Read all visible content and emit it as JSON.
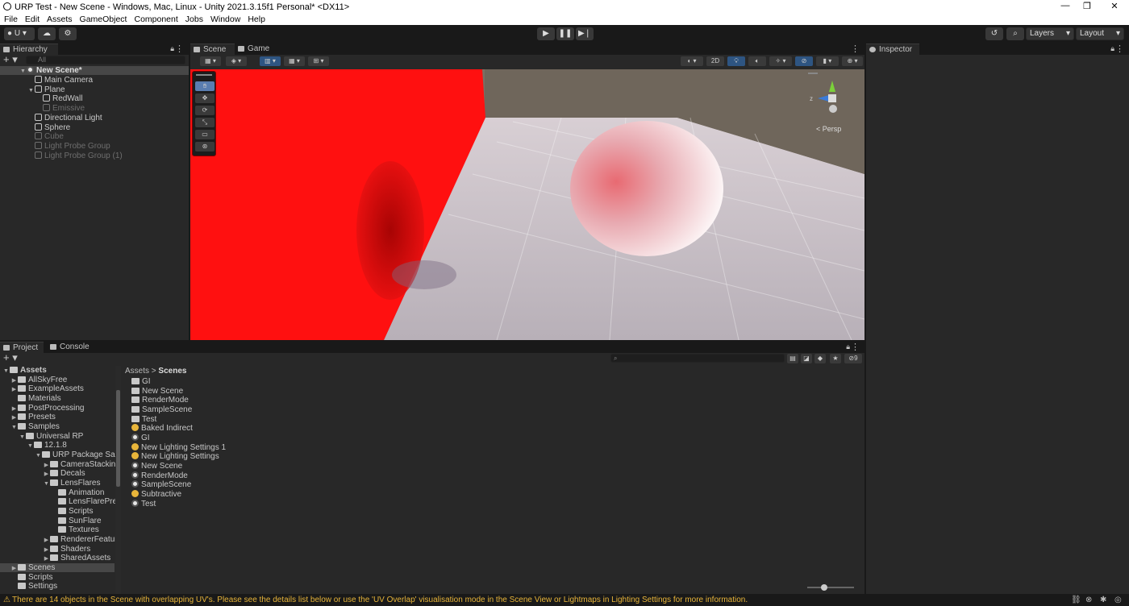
{
  "window": {
    "title": "URP Test - New Scene - Windows, Mac, Linux - Unity 2021.3.15f1 Personal* <DX11>",
    "controls": [
      "—",
      "❐",
      "✕"
    ]
  },
  "menu": [
    "File",
    "Edit",
    "Assets",
    "GameObject",
    "Component",
    "Jobs",
    "Window",
    "Help"
  ],
  "toolbar": {
    "account_label": "U",
    "layers_label": "Layers",
    "layout_label": "Layout"
  },
  "hierarchy": {
    "tab_label": "Hierarchy",
    "add_label": "+",
    "search_placeholder": "All",
    "scene_name": "New Scene*",
    "items": [
      {
        "label": "Main Camera",
        "depth": 1,
        "dim": false,
        "has_arrow": false
      },
      {
        "label": "Plane",
        "depth": 1,
        "dim": false,
        "has_arrow": true
      },
      {
        "label": "RedWall",
        "depth": 2,
        "dim": false,
        "has_arrow": false
      },
      {
        "label": "Emissive",
        "depth": 2,
        "dim": true,
        "has_arrow": false
      },
      {
        "label": "Directional Light",
        "depth": 1,
        "dim": false,
        "has_arrow": false
      },
      {
        "label": "Sphere",
        "depth": 1,
        "dim": false,
        "has_arrow": false
      },
      {
        "label": "Cube",
        "depth": 1,
        "dim": true,
        "has_arrow": false
      },
      {
        "label": "Light Probe Group",
        "depth": 1,
        "dim": true,
        "has_arrow": false
      },
      {
        "label": "Light Probe Group (1)",
        "depth": 1,
        "dim": true,
        "has_arrow": false
      }
    ]
  },
  "scene": {
    "tabs": [
      "Scene",
      "Game"
    ],
    "mode_2d": "2D",
    "persp_label": "Persp",
    "gizmo_axis": "z",
    "colors": {
      "red_wall": "#ff1010",
      "sky": "#7a7064",
      "floor": "#c9c2c8"
    }
  },
  "inspector": {
    "tab_label": "Inspector"
  },
  "project": {
    "tabs": [
      "Project",
      "Console"
    ],
    "add_label": "+",
    "breadcrumb": [
      "Assets",
      "Scenes"
    ],
    "hidden_count": "9",
    "tree": [
      {
        "label": "Assets",
        "depth": 0,
        "arrow": "▼",
        "bold": true
      },
      {
        "label": "AllSkyFree",
        "depth": 1,
        "arrow": "▶"
      },
      {
        "label": "ExampleAssets",
        "depth": 1,
        "arrow": "▶"
      },
      {
        "label": "Materials",
        "depth": 1,
        "arrow": ""
      },
      {
        "label": "PostProcessing",
        "depth": 1,
        "arrow": "▶"
      },
      {
        "label": "Presets",
        "depth": 1,
        "arrow": "▶"
      },
      {
        "label": "Samples",
        "depth": 1,
        "arrow": "▼"
      },
      {
        "label": "Universal RP",
        "depth": 2,
        "arrow": "▼"
      },
      {
        "label": "12.1.8",
        "depth": 3,
        "arrow": "▼"
      },
      {
        "label": "URP Package Sam",
        "depth": 4,
        "arrow": "▼"
      },
      {
        "label": "CameraStackin",
        "depth": 5,
        "arrow": "▶"
      },
      {
        "label": "Decals",
        "depth": 5,
        "arrow": "▶"
      },
      {
        "label": "LensFlares",
        "depth": 5,
        "arrow": "▼"
      },
      {
        "label": "Animation",
        "depth": 6,
        "arrow": ""
      },
      {
        "label": "LensFlarePre",
        "depth": 6,
        "arrow": ""
      },
      {
        "label": "Scripts",
        "depth": 6,
        "arrow": ""
      },
      {
        "label": "SunFlare",
        "depth": 6,
        "arrow": ""
      },
      {
        "label": "Textures",
        "depth": 6,
        "arrow": ""
      },
      {
        "label": "RendererFeatur",
        "depth": 5,
        "arrow": "▶"
      },
      {
        "label": "Shaders",
        "depth": 5,
        "arrow": "▶"
      },
      {
        "label": "SharedAssets",
        "depth": 5,
        "arrow": "▶"
      },
      {
        "label": "Scenes",
        "depth": 1,
        "arrow": "▶",
        "selected": true
      },
      {
        "label": "Scripts",
        "depth": 1,
        "arrow": ""
      },
      {
        "label": "Settings",
        "depth": 1,
        "arrow": ""
      }
    ],
    "files": [
      {
        "label": "GI",
        "kind": "folder"
      },
      {
        "label": "New Scene",
        "kind": "folder"
      },
      {
        "label": "RenderMode",
        "kind": "folder"
      },
      {
        "label": "SampleScene",
        "kind": "folder"
      },
      {
        "label": "Test",
        "kind": "folder"
      },
      {
        "label": "Baked Indirect",
        "kind": "light"
      },
      {
        "label": "GI",
        "kind": "scene"
      },
      {
        "label": "New Lighting Settings 1",
        "kind": "light"
      },
      {
        "label": "New Lighting Settings",
        "kind": "light"
      },
      {
        "label": "New Scene",
        "kind": "scene"
      },
      {
        "label": "RenderMode",
        "kind": "scene"
      },
      {
        "label": "SampleScene",
        "kind": "scene"
      },
      {
        "label": "Subtractive",
        "kind": "light"
      },
      {
        "label": "Test",
        "kind": "scene"
      }
    ]
  },
  "status": {
    "message": "There are 14 objects in the Scene with overlapping UV's. Please see the details list below or use the 'UV Overlap' visualisation mode in the Scene View or Lightmaps in Lighting Settings for more information.",
    "warning_color": "#e8b53a"
  }
}
